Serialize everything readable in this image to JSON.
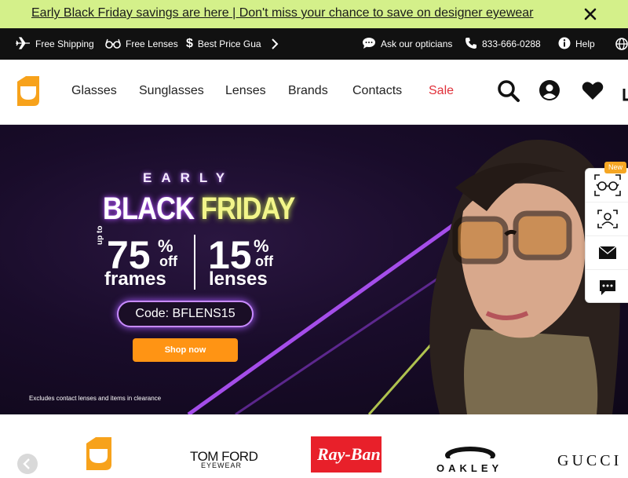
{
  "promo": {
    "text": "Early Black Friday savings are here | Don't miss your chance to save on designer eyewear",
    "close_icon": "close-icon"
  },
  "utility": {
    "items": [
      {
        "label": "Free Shipping",
        "icon": "airplane-icon"
      },
      {
        "label": "Free Lenses",
        "icon": "glasses-icon"
      },
      {
        "label": "Best Price Gua",
        "icon": "dollar-icon"
      }
    ],
    "next_icon": "chevron-right-icon",
    "ask": "Ask our opticians",
    "phone": "833-666-0288",
    "help": "Help",
    "globe_icon": "globe-icon"
  },
  "header": {
    "nav": [
      "Glasses",
      "Sunglasses",
      "Lenses",
      "Brands",
      "Contacts",
      "Sale"
    ],
    "icons": [
      "search-icon",
      "account-icon",
      "heart-icon",
      "cart-icon"
    ]
  },
  "hero": {
    "early": "EARLY",
    "black": "BLACK",
    "friday": "FRIDAY",
    "up_to": "up to",
    "pct1": "75",
    "pct1_sym": "%",
    "off1": "off",
    "frames": "frames",
    "pct2": "15",
    "pct2_sym": "%",
    "off2": "off",
    "lenses": "lenses",
    "code": "Code: BFLENS15",
    "cta": "Shop now",
    "disclaimer": "Excludes contact lenses and items in clearance"
  },
  "side_toolbar": {
    "badge": "New",
    "buttons": [
      "virtual-try-on-icon",
      "face-scan-icon",
      "email-icon",
      "chat-icon"
    ]
  },
  "brands": {
    "tomford": "TOM FORD",
    "tomford_sub": "EYEWEAR",
    "rayban": "Ray-Ban",
    "oakley": "OAKLEY",
    "gucci": "GUCCI"
  },
  "colors": {
    "promo_bg": "#d4f08a",
    "utility_bg": "#111111",
    "sale": "#e0313a",
    "accent_orange": "#f5a623",
    "cta": "#ff9414",
    "neon_purple": "#b455ff",
    "neon_yellow": "#f2f58a"
  }
}
